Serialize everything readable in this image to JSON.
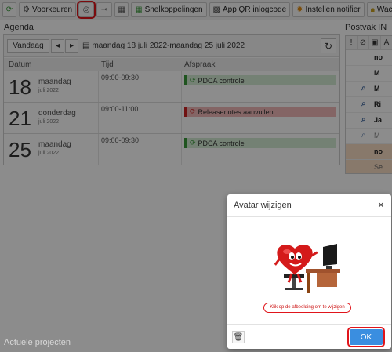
{
  "toolbar": {
    "voorkeuren": "Voorkeuren",
    "snelkoppelingen": "Snelkoppelingen",
    "app_qr": "App QR inlogcode",
    "instellen_notifier": "Instellen notifier",
    "wachtwoord": "Wachtwoord ge"
  },
  "agenda": {
    "title": "Agenda",
    "today_button": "Vandaag",
    "date_range": "maandag 18 juli 2022-maandag 25 juli 2022",
    "columns": {
      "datum": "Datum",
      "tijd": "Tijd",
      "afspraak": "Afspraak"
    },
    "rows": [
      {
        "day": "18",
        "weekday": "maandag",
        "month_year": "juli 2022",
        "time": "09:00-09:30",
        "appointment": "PDCA controle",
        "status_color": "#3a9a3a"
      },
      {
        "day": "21",
        "weekday": "donderdag",
        "month_year": "juli 2022",
        "time": "09:00-11:00",
        "appointment": "Releasenotes aanvullen",
        "status_color": "#cc2222"
      },
      {
        "day": "25",
        "weekday": "maandag",
        "month_year": "juli 2022",
        "time": "09:00-09:30",
        "appointment": "PDCA controle",
        "status_color": "#3a9a3a"
      }
    ]
  },
  "postvak": {
    "title": "Postvak IN",
    "header_icons": [
      "!",
      "clip",
      "lock",
      "A"
    ],
    "rows": [
      {
        "text": "no",
        "has_attachment": false
      },
      {
        "text": "M",
        "has_attachment": false
      },
      {
        "text": "M",
        "has_attachment": true
      },
      {
        "text": "Ri",
        "has_attachment": true
      },
      {
        "text": "Ja",
        "has_attachment": true
      },
      {
        "text": "M",
        "has_attachment": true
      },
      {
        "text": "no",
        "has_attachment": false
      },
      {
        "text": "Se",
        "has_attachment": false
      }
    ]
  },
  "projects": {
    "title": "Actuele projecten"
  },
  "modal": {
    "title": "Avatar wijzigen",
    "close": "×",
    "avatar_hint": "Klik op de afbeelding om te wijzigen",
    "ok": "OK"
  },
  "colors": {
    "highlight": "#e0151b",
    "ok_button": "#3a8ee0",
    "appt_green": "#d4ecd4",
    "appt_red": "#f0b8b8"
  }
}
